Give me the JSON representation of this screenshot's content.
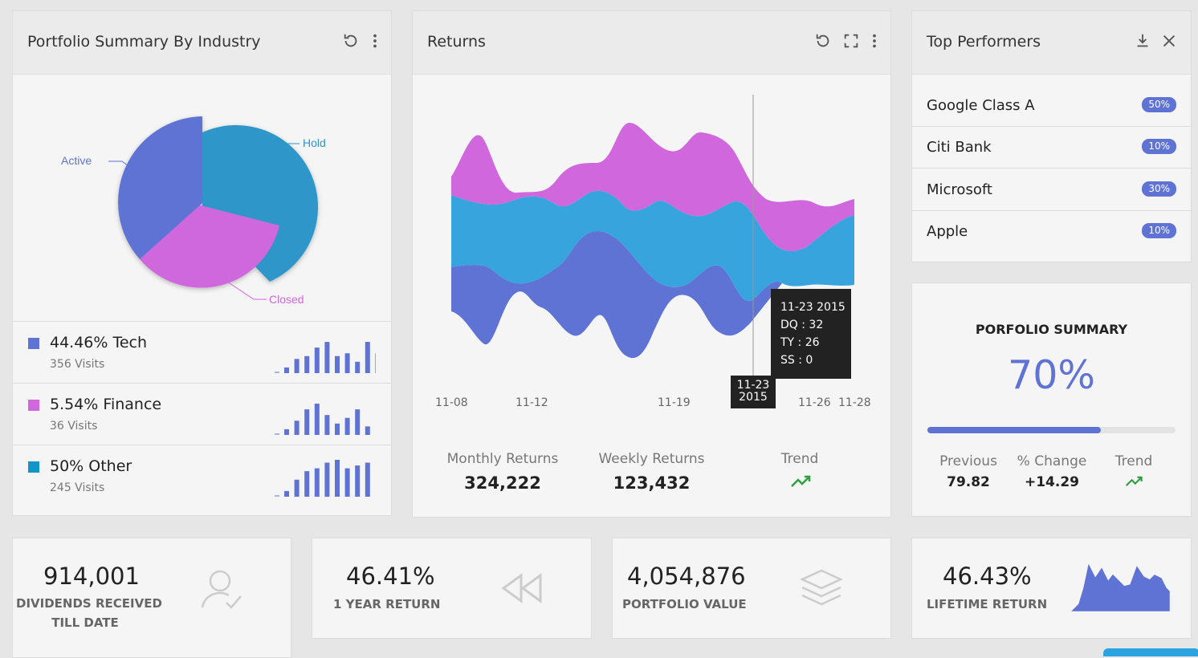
{
  "portfolio_industry": {
    "title": "Portfolio Summary By Industry",
    "pie": {
      "labels": {
        "active": "Active",
        "hold": "Hold",
        "closed": "Closed"
      },
      "colors": {
        "active": "#5f73d4",
        "hold": "#2f96c8",
        "closed": "#d067dd"
      }
    },
    "rows": [
      {
        "title": "44.46% Tech",
        "visits": "356 Visits",
        "color": "#5f73d4",
        "bars": [
          2,
          5,
          6,
          9,
          11,
          6,
          7,
          4,
          11,
          7
        ]
      },
      {
        "title": "5.54% Finance",
        "visits": "36 Visits",
        "color": "#d067dd",
        "bars": [
          2,
          5,
          9,
          11,
          7,
          4,
          6,
          9,
          3
        ]
      },
      {
        "title": "50% Other",
        "visits": "245 Visits",
        "color": "#1296c8",
        "bars": [
          2,
          6,
          9,
          10,
          12,
          13,
          10,
          11,
          12
        ]
      }
    ]
  },
  "returns": {
    "title": "Returns",
    "x_ticks": [
      "11-08",
      "11-12",
      "11-19",
      "11-23\n2015",
      "11-26",
      "11-28"
    ],
    "tooltip": {
      "date": "11-23 2015",
      "lines": [
        "DQ : 32",
        "TY : 26",
        "SS : 0"
      ]
    },
    "colors": {
      "DQ": "#d067dd",
      "TY": "#38a4dd",
      "SS": "#5f73d4"
    },
    "stats": [
      {
        "label": "Monthly Returns",
        "value": "324,222"
      },
      {
        "label": "Weekly Returns",
        "value": "123,432"
      },
      {
        "label": "Trend",
        "value": ""
      }
    ]
  },
  "top_performers": {
    "title": "Top Performers",
    "items": [
      {
        "name": "Google Class A",
        "badge": "50%"
      },
      {
        "name": "Citi Bank",
        "badge": "10%"
      },
      {
        "name": "Microsoft",
        "badge": "30%"
      },
      {
        "name": "Apple",
        "badge": "10%"
      }
    ]
  },
  "portfolio_summary": {
    "title": "PORFOLIO SUMMARY",
    "value": "70%",
    "progress": 0.7,
    "stats": [
      {
        "label": "Previous",
        "value": "79.82"
      },
      {
        "label": "% Change",
        "value": "+14.29"
      },
      {
        "label": "Trend",
        "value": ""
      }
    ]
  },
  "kpis": [
    {
      "value": "914,001",
      "label_line1": "DIVIDENDS RECEIVED",
      "label_line2": "TILL DATE",
      "icon": "user-check-icon"
    },
    {
      "value": "46.41%",
      "label_line1": "1 YEAR RETURN",
      "icon": "rewind-icon"
    },
    {
      "value": "4,054,876",
      "label_line1": "PORTFOLIO VALUE",
      "icon": "layers-icon"
    },
    {
      "value": "46.43%",
      "label_line1": "LIFETIME RETURN",
      "icon": "area-sparkline"
    }
  ],
  "accent_color": "#5f73d4",
  "trend_color": "#2e9e3e"
}
